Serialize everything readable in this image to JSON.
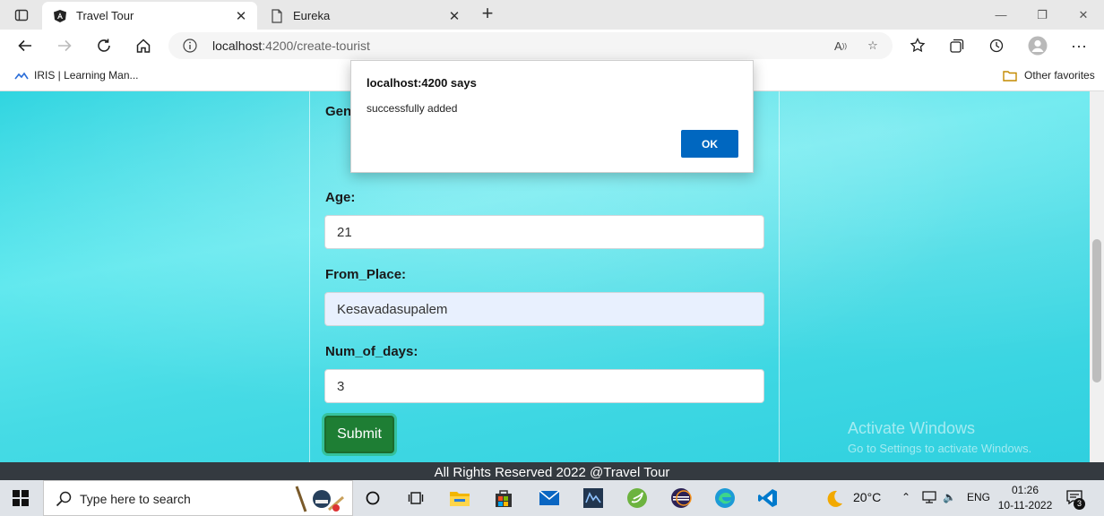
{
  "browser": {
    "tabs": [
      {
        "title": "Travel Tour",
        "active": true,
        "icon": "angular-icon"
      },
      {
        "title": "Eureka",
        "active": false,
        "icon": "page-icon"
      }
    ],
    "url_host": "localhost",
    "url_path": ":4200/create-tourist",
    "favorites": [
      {
        "label": "IRIS | Learning Man...",
        "icon": "iris-icon"
      },
      {
        "label": "Other favorites",
        "icon": "folder-icon"
      }
    ]
  },
  "form": {
    "gender_label": "Gen",
    "age_label": "Age:",
    "age_value": "21",
    "from_place_label": "From_Place:",
    "from_place_value": "Kesavadasupalem",
    "num_days_label": "Num_of_days:",
    "num_days_value": "3",
    "submit_label": "Submit"
  },
  "watermark": {
    "line1": "Activate Windows",
    "line2": "Go to Settings to activate Windows."
  },
  "footer": {
    "text": "All Rights Reserved 2022 @Travel Tour"
  },
  "dialog": {
    "title": "localhost:4200 says",
    "message": "successfully added",
    "ok_label": "OK"
  },
  "taskbar": {
    "search_placeholder": "Type here to search",
    "weather": "20°C",
    "language": "ENG",
    "time": "01:26",
    "date": "10-11-2022",
    "notification_count": "3"
  },
  "colors": {
    "accent": "#0067c0",
    "submit_green": "#1e7e34",
    "footer_bg": "#343a40",
    "page_cyan": "#46dbe5"
  }
}
